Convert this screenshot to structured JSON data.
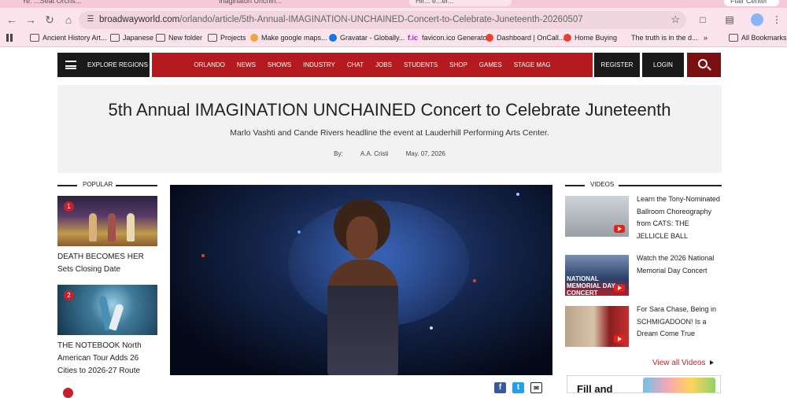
{
  "browser": {
    "tabs": [
      "Ye. ...Seat Orchs...",
      "Ihaginaton Unchin...",
      "Hlr... e...er...",
      "Flair Center"
    ],
    "url_domain": "broadwayworld.com",
    "url_path": "/orlando/article/5th-Annual-IMAGINATION-UNCHAINED-Concert-to-Celebrate-Juneteenth-20260507",
    "bookmarks": [
      {
        "label": "Ancient History Art...",
        "icon": "folder-icon"
      },
      {
        "label": "Japanese",
        "icon": "folder-icon"
      },
      {
        "label": "New folder",
        "icon": "folder-icon"
      },
      {
        "label": "Projects",
        "icon": "folder-icon"
      },
      {
        "label": "Make google maps...",
        "icon": "maps-favicon"
      },
      {
        "label": "Gravatar - Globally...",
        "icon": "gravatar-favicon"
      },
      {
        "label": "favicon.ico Generator",
        "icon": "favicon-generator-favicon"
      },
      {
        "label": "Dashboard | OnCall...",
        "icon": "oncall-favicon"
      },
      {
        "label": "Home Buying",
        "icon": "home-buying-favicon"
      },
      {
        "label": "The truth is in the d...",
        "icon": "none"
      },
      {
        "label": "All Bookmarks",
        "icon": "folder-icon"
      }
    ],
    "overflow_label": "»"
  },
  "site_nav": {
    "explore_label": "EXPLORE REGIONS",
    "menu": [
      "ORLANDO",
      "NEWS",
      "SHOWS",
      "INDUSTRY",
      "CHAT",
      "JOBS",
      "STUDENTS",
      "SHOP",
      "GAMES",
      "STAGE MAG"
    ],
    "register_label": "REGISTER",
    "login_label": "LOGIN"
  },
  "article": {
    "title": "5th Annual IMAGINATION UNCHAINED Concert to Celebrate Juneteenth",
    "subtitle": "Marlo Vashti and Cande Rivers headline the event at Lauderhill Performing Arts Center.",
    "by_label": "By:",
    "author": "A.A. Cristi",
    "date": "May. 07, 2026"
  },
  "popular": {
    "heading": "POPULAR",
    "items": [
      {
        "rank": "1",
        "caption": "DEATH BECOMES HER Sets Closing Date"
      },
      {
        "rank": "2",
        "caption": "THE NOTEBOOK North American Tour Adds 26 Cities to 2026-27 Route"
      }
    ]
  },
  "videos": {
    "heading": "VIDEOS",
    "items": [
      {
        "caption": "Learn the Tony-Nominated Ballroom Choreography from CATS: THE JELLICLE BALL"
      },
      {
        "caption": "Watch the 2026 National Memorial Day Concert",
        "overlay": "NATIONAL MEMORIAL DAY CONCERT"
      },
      {
        "caption": "For Sara Chase, Being in SCHMIGADOON! Is a Dream Come True"
      }
    ],
    "view_all_label": "View all Videos"
  },
  "ad": {
    "text": "Fill and"
  },
  "colors": {
    "brand_red": "#b41a1e",
    "dark": "#1a1a1a",
    "accent_red": "#c8202a"
  }
}
